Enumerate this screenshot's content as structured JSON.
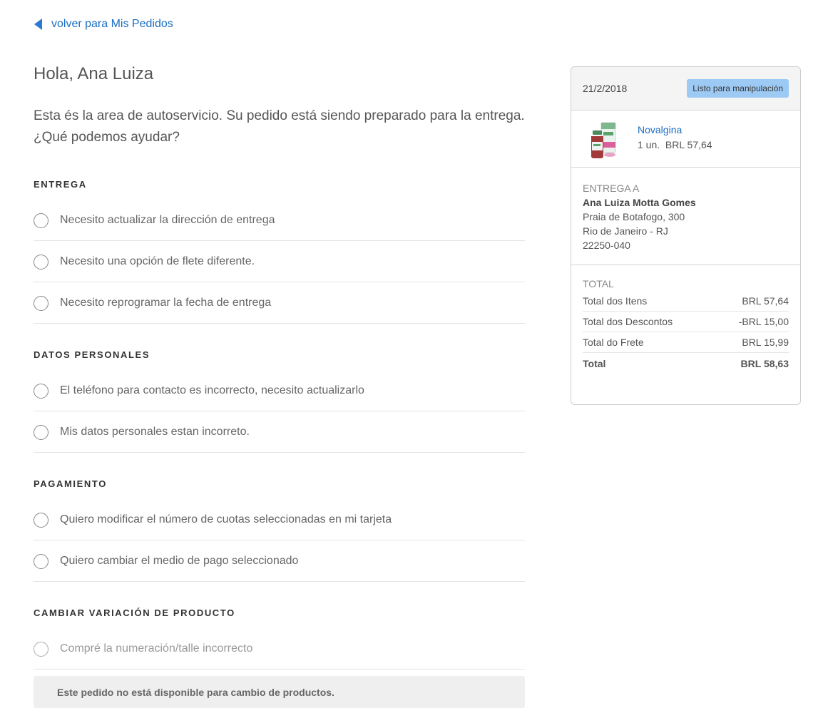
{
  "back_link": {
    "label": "volver para Mis Pedidos"
  },
  "greeting": "Hola, Ana Luiza",
  "intro": "Esta és la area de autoservicio. Su pedido está siendo preparado para la entrega. ¿Qué podemos ayudar?",
  "sections": [
    {
      "title": "ENTREGA",
      "options": [
        "Necesito actualizar la dirección de entrega",
        "Necesito una opción de flete diferente.",
        "Necesito reprogramar la fecha de entrega"
      ]
    },
    {
      "title": "DATOS PERSONALES",
      "options": [
        "El teléfono para contacto es incorrecto, necesito actualizarlo",
        "Mis datos personales estan incorreto."
      ]
    },
    {
      "title": "PAGAMIENTO",
      "options": [
        "Quiero modificar el número de cuotas seleccionadas en mi tarjeta",
        "Quiero cambiar el medio de pago seleccionado"
      ]
    },
    {
      "title": "CAMBIAR VARIACIÓN DE PRODUCTO",
      "options": [
        "Compré la numeración/talle incorrecto"
      ],
      "notice": "Este pedido no está disponible para cambio de productos."
    }
  ],
  "order_card": {
    "date": "21/2/2018",
    "status": "Listo para manipulación",
    "status_color": "#9ccaf4",
    "product": {
      "name": "Novalgina",
      "quantity": "1 un.",
      "price": "BRL 57,64"
    },
    "delivery": {
      "label": "ENTREGA A",
      "name": "Ana Luiza Motta Gomes",
      "street": "Praia de Botafogo, 300",
      "city": "Rio de Janeiro - RJ",
      "zip": "22250-040"
    },
    "totals": {
      "label": "TOTAL",
      "rows": [
        {
          "label": "Total dos Itens",
          "value": "BRL 57,64"
        },
        {
          "label": "Total dos Descontos",
          "value": "-BRL 15,00"
        },
        {
          "label": "Total do Frete",
          "value": "BRL 15,99"
        },
        {
          "label": "Total",
          "value": "BRL 58,63"
        }
      ]
    }
  },
  "colors": {
    "link": "#1b6ec2",
    "accent_arrow": "#2a7ad4"
  }
}
